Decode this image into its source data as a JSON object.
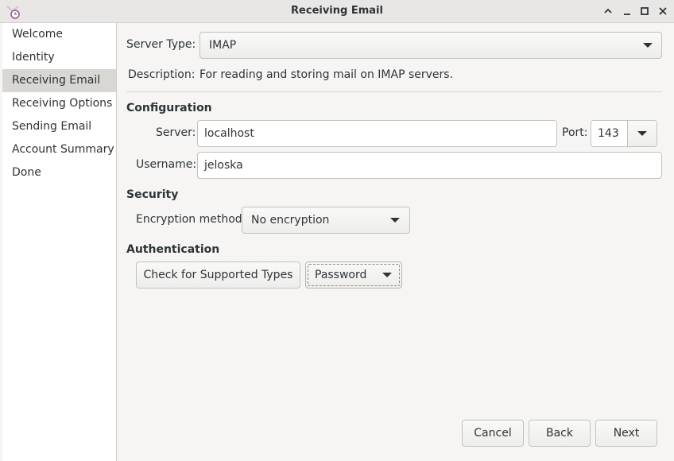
{
  "window": {
    "title": "Receiving Email",
    "icons": [
      "app-icon",
      "chevron-up-icon",
      "minimize-icon",
      "maximize-icon",
      "close-icon"
    ]
  },
  "sidebar": {
    "items": [
      {
        "label": "Welcome"
      },
      {
        "label": "Identity"
      },
      {
        "label": "Receiving Email"
      },
      {
        "label": "Receiving Options"
      },
      {
        "label": "Sending Email"
      },
      {
        "label": "Account Summary"
      },
      {
        "label": "Done"
      }
    ],
    "selected": "Receiving Email"
  },
  "server_type": {
    "label": "Server Type:",
    "value": "IMAP"
  },
  "description": {
    "label": "Description:",
    "value": "For reading and storing mail on IMAP servers."
  },
  "configuration": {
    "heading": "Configuration",
    "server_label": "Server:",
    "server_value": "localhost",
    "port_label": "Port:",
    "port_value": "143",
    "username_label": "Username:",
    "username_value": "jeloska"
  },
  "security": {
    "heading": "Security",
    "encryption_label": "Encryption method:",
    "encryption_value": "No encryption"
  },
  "authentication": {
    "heading": "Authentication",
    "check_button": "Check for Supported Types",
    "method_value": "Password"
  },
  "footer": {
    "cancel": "Cancel",
    "back": "Back",
    "next": "Next"
  },
  "colors": {
    "window_bg": "#f6f5f4",
    "sidebar_selected": "#d8d7d4",
    "text": "#2e3436"
  }
}
